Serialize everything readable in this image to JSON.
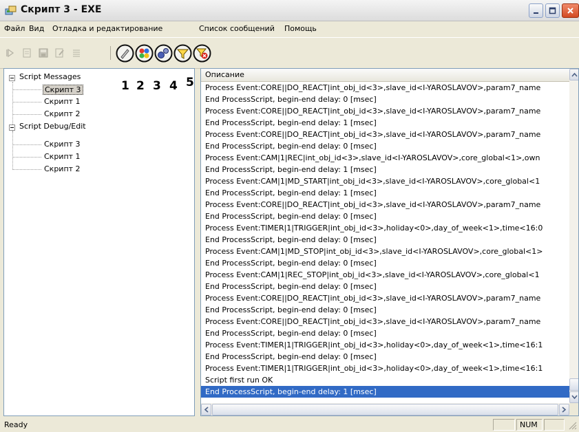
{
  "window": {
    "title": "Скрипт 3 - EXE"
  },
  "menu": [
    {
      "label": "Файл"
    },
    {
      "label": "Вид"
    },
    {
      "label": "Отладка и редактирование"
    },
    {
      "label": "Список сообщений"
    },
    {
      "label": "Помощь"
    }
  ],
  "annotations": [
    "1",
    "2",
    "3",
    "4",
    "5"
  ],
  "tree": {
    "groups": [
      {
        "label": "Script Messages",
        "children": [
          "Скрипт 3",
          "Скрипт 1",
          "Скрипт 2"
        ],
        "selected_child": 0
      },
      {
        "label": "Script Debug/Edit",
        "children": [
          "Скрипт 3",
          "Скрипт 1",
          "Скрипт 2"
        ]
      }
    ]
  },
  "list": {
    "header": "Описание",
    "rows": [
      "Process Event:CORE||DO_REACT|int_obj_id<3>,slave_id<I-YAROSLAVOV>,param7_name",
      "End ProcessScript, begin-end delay: 0 [msec]",
      "Process Event:CORE||DO_REACT|int_obj_id<3>,slave_id<I-YAROSLAVOV>,param7_name",
      "End ProcessScript, begin-end delay: 1 [msec]",
      "Process Event:CORE||DO_REACT|int_obj_id<3>,slave_id<I-YAROSLAVOV>,param7_name",
      "End ProcessScript, begin-end delay: 0 [msec]",
      "Process Event:CAM|1|REC|int_obj_id<3>,slave_id<I-YAROSLAVOV>,core_global<1>,own",
      "End ProcessScript, begin-end delay: 1 [msec]",
      "Process Event:CAM|1|MD_START|int_obj_id<3>,slave_id<I-YAROSLAVOV>,core_global<1",
      "End ProcessScript, begin-end delay: 1 [msec]",
      "Process Event:CORE||DO_REACT|int_obj_id<3>,slave_id<I-YAROSLAVOV>,param7_name",
      "End ProcessScript, begin-end delay: 0 [msec]",
      "Process Event:TIMER|1|TRIGGER|int_obj_id<3>,holiday<0>,day_of_week<1>,time<16:0",
      "End ProcessScript, begin-end delay: 0 [msec]",
      "Process Event:CAM|1|MD_STOP|int_obj_id<3>,slave_id<I-YAROSLAVOV>,core_global<1>",
      "End ProcessScript, begin-end delay: 0 [msec]",
      "Process Event:CAM|1|REC_STOP|int_obj_id<3>,slave_id<I-YAROSLAVOV>,core_global<1",
      "End ProcessScript, begin-end delay: 0 [msec]",
      "Process Event:CORE||DO_REACT|int_obj_id<3>,slave_id<I-YAROSLAVOV>,param7_name",
      "End ProcessScript, begin-end delay: 0 [msec]",
      "Process Event:CORE||DO_REACT|int_obj_id<3>,slave_id<I-YAROSLAVOV>,param7_name",
      "End ProcessScript, begin-end delay: 0 [msec]",
      "Process Event:TIMER|1|TRIGGER|int_obj_id<3>,holiday<0>,day_of_week<1>,time<16:1",
      "End ProcessScript, begin-end delay: 0 [msec]",
      "Process Event:TIMER|1|TRIGGER|int_obj_id<3>,holiday<0>,day_of_week<1>,time<16:1",
      "Script first run OK",
      "End ProcessScript, begin-end delay: 1 [msec]"
    ],
    "selected_row": 26
  },
  "status": {
    "text": "Ready",
    "num": "NUM"
  },
  "colors": {
    "selection": "#316ac5",
    "close_button": "#d24a22"
  }
}
